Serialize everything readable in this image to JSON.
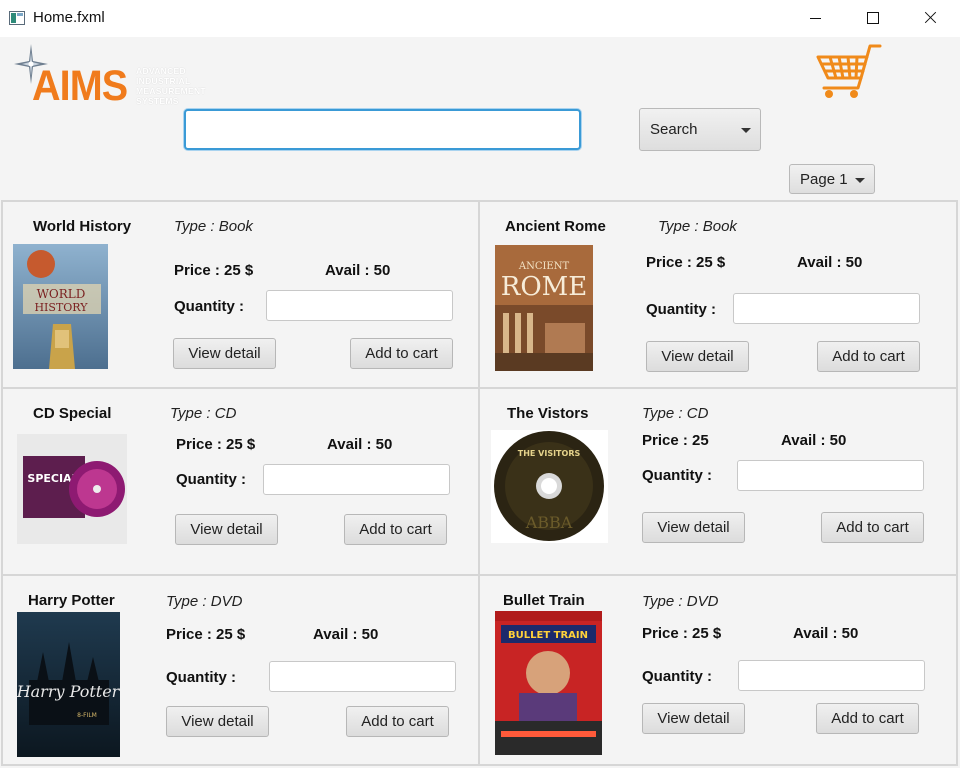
{
  "window": {
    "title": "Home.fxml"
  },
  "header": {
    "logo": {
      "text": "AIMS",
      "subtitle": "ADVANCED INDUSTRIAL MEASUREMENT SYSTEMS",
      "color": "#f07b1c"
    },
    "cart_icon": "shopping-cart-icon",
    "search": {
      "value": "",
      "placeholder": ""
    },
    "search_combo": {
      "selected": "Search"
    },
    "page_combo": {
      "selected": "Page 1"
    }
  },
  "labels": {
    "quantity": "Quantity :",
    "view_detail": "View detail",
    "add_to_cart": "Add to cart"
  },
  "products": [
    {
      "name": "World History",
      "type": "Type : Book",
      "price": "Price : 25 $",
      "avail": "Avail : 50",
      "cover_title": "WORLD HISTORY"
    },
    {
      "name": "Ancient Rome",
      "type": "Type : Book",
      "price": "Price : 25 $",
      "avail": "Avail : 50",
      "cover_title": "ROME"
    },
    {
      "name": "CD Special",
      "type": "Type : CD",
      "price": "Price : 25 $",
      "avail": "Avail : 50",
      "cover_title": "SPECIAL"
    },
    {
      "name": "The Vistors",
      "type": "Type : CD",
      "price": "Price : 25",
      "avail": "Avail : 50",
      "cover_title": "THE VISITORS"
    },
    {
      "name": "Harry Potter",
      "type": "Type : DVD",
      "price": "Price : 25 $",
      "avail": "Avail : 50",
      "cover_title": "Harry Potter"
    },
    {
      "name": "Bullet Train",
      "type": "Type : DVD",
      "price": "Price : 25 $",
      "avail": "Avail : 50",
      "cover_title": "BULLET TRAIN"
    }
  ]
}
